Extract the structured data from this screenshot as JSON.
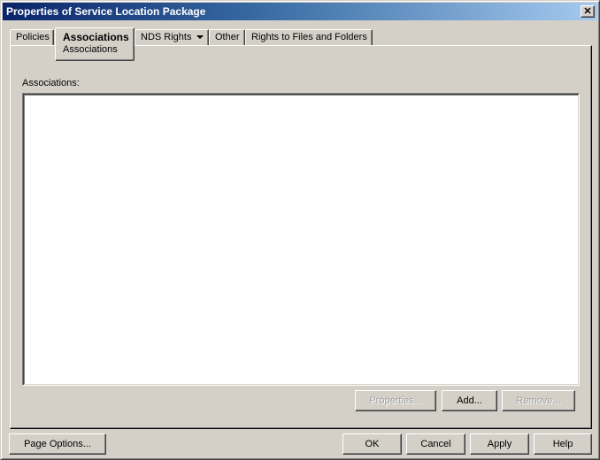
{
  "window": {
    "title": "Properties of Service Location Package",
    "close_glyph": "✕"
  },
  "tabs": [
    {
      "label": "Policies",
      "active": false
    },
    {
      "label": "Associations",
      "sub_label": "Associations",
      "active": true
    },
    {
      "label": "NDS Rights",
      "has_dropdown": true,
      "active": false
    },
    {
      "label": "Other",
      "active": false
    },
    {
      "label": "Rights to Files and Folders",
      "active": false
    }
  ],
  "content": {
    "list_label": "Associations:",
    "list_items": []
  },
  "list_buttons": {
    "properties": {
      "label": "Properties...",
      "enabled": false
    },
    "add": {
      "label": "Add...",
      "enabled": true
    },
    "remove": {
      "label": "Remove...",
      "enabled": false
    }
  },
  "footer": {
    "page_options": "Page Options...",
    "ok": "OK",
    "cancel": "Cancel",
    "apply": "Apply",
    "help": "Help"
  }
}
